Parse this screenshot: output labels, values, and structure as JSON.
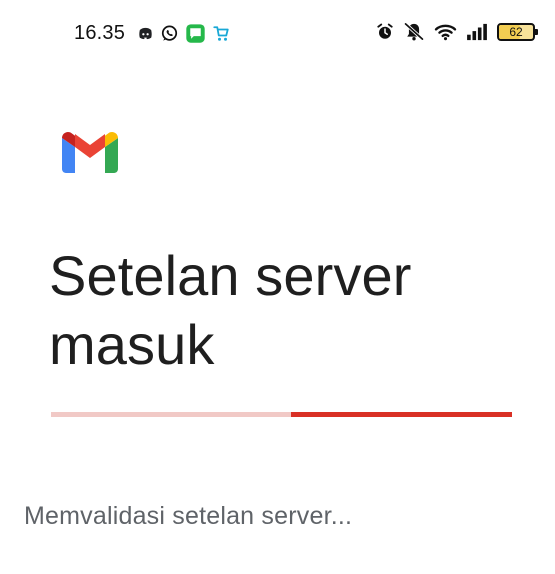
{
  "status_bar": {
    "time": "16.35",
    "battery_level": "62",
    "left_icons": [
      "discord-icon",
      "whatsapp-icon",
      "messages-icon",
      "shopping-cart-icon"
    ],
    "right_icons": [
      "alarm-icon",
      "silent-mode-icon",
      "wifi-icon",
      "signal-icon",
      "battery-icon"
    ]
  },
  "page": {
    "title": "Setelan server masuk",
    "status_message": "Memvalidasi setelan server...",
    "progress_indicator_start": 0.52,
    "progress_indicator_end": 1.0
  },
  "colors": {
    "gmail_blue": "#4285F4",
    "gmail_red": "#EA4335",
    "gmail_yellow": "#FBBC04",
    "gmail_green": "#34A853",
    "progress_track": "#F1C9C6",
    "progress_indicator": "#D93025",
    "status_text": "#5F6368"
  }
}
